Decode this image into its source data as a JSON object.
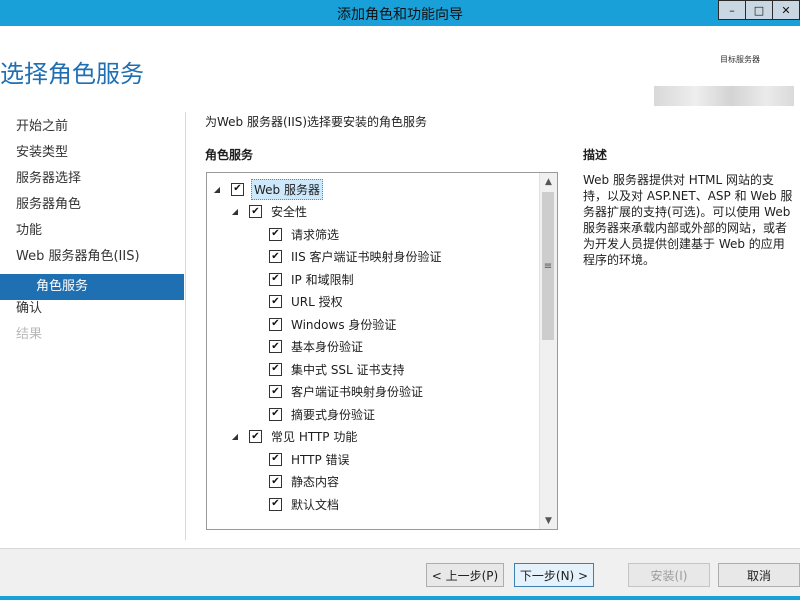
{
  "window": {
    "title": "添加角色和功能向导",
    "minimize_glyph": "–",
    "maximize_glyph": "□",
    "close_glyph": "✕"
  },
  "header": {
    "page_title": "选择角色服务",
    "server_label": "目标服务器"
  },
  "nav": {
    "items": [
      {
        "label": "开始之前",
        "state": "normal"
      },
      {
        "label": "安装类型",
        "state": "normal"
      },
      {
        "label": "服务器选择",
        "state": "normal"
      },
      {
        "label": "服务器角色",
        "state": "normal"
      },
      {
        "label": "功能",
        "state": "normal"
      },
      {
        "label": "Web 服务器角色(IIS)",
        "state": "normal"
      },
      {
        "label": "角色服务",
        "state": "selected"
      },
      {
        "label": "确认",
        "state": "normal"
      },
      {
        "label": "结果",
        "state": "disabled"
      }
    ]
  },
  "main": {
    "instruction": "为Web 服务器(IIS)选择要安装的角色服务",
    "roles_heading": "角色服务",
    "tree": [
      {
        "label": "Web 服务器",
        "level": 0,
        "checked": true,
        "expanded": true
      },
      {
        "label": "安全性",
        "level": 1,
        "checked": true,
        "expanded": true
      },
      {
        "label": "请求筛选",
        "level": 2,
        "checked": true
      },
      {
        "label": "IIS 客户端证书映射身份验证",
        "level": 2,
        "checked": true
      },
      {
        "label": "IP 和域限制",
        "level": 2,
        "checked": true
      },
      {
        "label": "URL 授权",
        "level": 2,
        "checked": true
      },
      {
        "label": "Windows 身份验证",
        "level": 2,
        "checked": true
      },
      {
        "label": "基本身份验证",
        "level": 2,
        "checked": true
      },
      {
        "label": "集中式 SSL 证书支持",
        "level": 2,
        "checked": true
      },
      {
        "label": "客户端证书映射身份验证",
        "level": 2,
        "checked": true
      },
      {
        "label": "摘要式身份验证",
        "level": 2,
        "checked": true
      },
      {
        "label": "常见 HTTP 功能",
        "level": 1,
        "checked": true,
        "expanded": true
      },
      {
        "label": "HTTP 错误",
        "level": 2,
        "checked": true
      },
      {
        "label": "静态内容",
        "level": 2,
        "checked": true
      },
      {
        "label": "默认文档",
        "level": 2,
        "checked": true
      }
    ]
  },
  "description": {
    "heading": "描述",
    "text": "Web 服务器提供对 HTML 网站的支持，以及对 ASP.NET、ASP 和 Web 服务器扩展的支持(可选)。可以使用 Web 服务器来承载内部或外部的网站，或者为开发人员提供创建基于 Web 的应用程序的环境。"
  },
  "footer": {
    "prev_label": "< 上一步(P)",
    "next_label": "下一步(N) >",
    "install_label": "安装(I)",
    "cancel_label": "取消"
  },
  "colors": {
    "titlebar": "#1aa0d8",
    "accent": "#1f6fb3",
    "selection": "#cde8fb"
  }
}
